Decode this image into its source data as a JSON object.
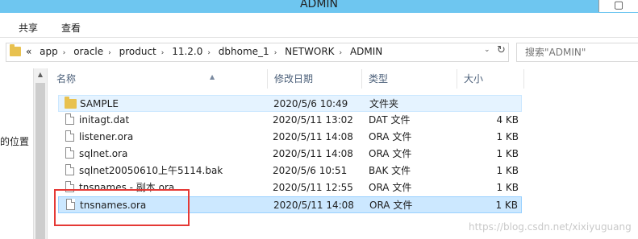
{
  "window": {
    "title": "ADMIN",
    "control_glyph": "▢"
  },
  "ribbon": {
    "tabs": [
      "共享",
      "查看"
    ]
  },
  "address": {
    "overflow": "«",
    "crumbs": [
      "app",
      "oracle",
      "product",
      "11.2.0",
      "dbhome_1",
      "NETWORK",
      "ADMIN"
    ],
    "separator": "›",
    "dropdown": "⌄",
    "refresh": "↻"
  },
  "search": {
    "placeholder": "搜索\"ADMIN\""
  },
  "nav": {
    "partial_label": "的位置"
  },
  "columns": {
    "name": "名称",
    "modified": "修改日期",
    "type": "类型",
    "size": "大小"
  },
  "files": [
    {
      "name": "SAMPLE",
      "modified": "2020/5/6 10:49",
      "type": "文件夹",
      "size": "",
      "icon": "folder-icon",
      "state": "hover"
    },
    {
      "name": "initagt.dat",
      "modified": "2020/5/11 13:02",
      "type": "DAT 文件",
      "size": "4 KB",
      "icon": "file-icon",
      "state": ""
    },
    {
      "name": "listener.ora",
      "modified": "2020/5/11 14:08",
      "type": "ORA 文件",
      "size": "1 KB",
      "icon": "file-icon",
      "state": ""
    },
    {
      "name": "sqlnet.ora",
      "modified": "2020/5/11 14:08",
      "type": "ORA 文件",
      "size": "1 KB",
      "icon": "file-icon",
      "state": ""
    },
    {
      "name": "sqlnet20050610上午5114.bak",
      "modified": "2020/5/6 10:51",
      "type": "BAK 文件",
      "size": "1 KB",
      "icon": "file-icon",
      "state": ""
    },
    {
      "name": "tnsnames - 副本.ora",
      "modified": "2020/5/11 12:55",
      "type": "ORA 文件",
      "size": "1 KB",
      "icon": "file-icon",
      "state": ""
    },
    {
      "name": "tnsnames.ora",
      "modified": "2020/5/11 14:08",
      "type": "ORA 文件",
      "size": "1 KB",
      "icon": "file-icon",
      "state": "sel"
    }
  ],
  "watermark": "https://blog.csdn.net/xixiyuguang",
  "colors": {
    "titlebar": "#6ec6f0",
    "selection": "#cce8ff",
    "annotation": "#e53935"
  }
}
